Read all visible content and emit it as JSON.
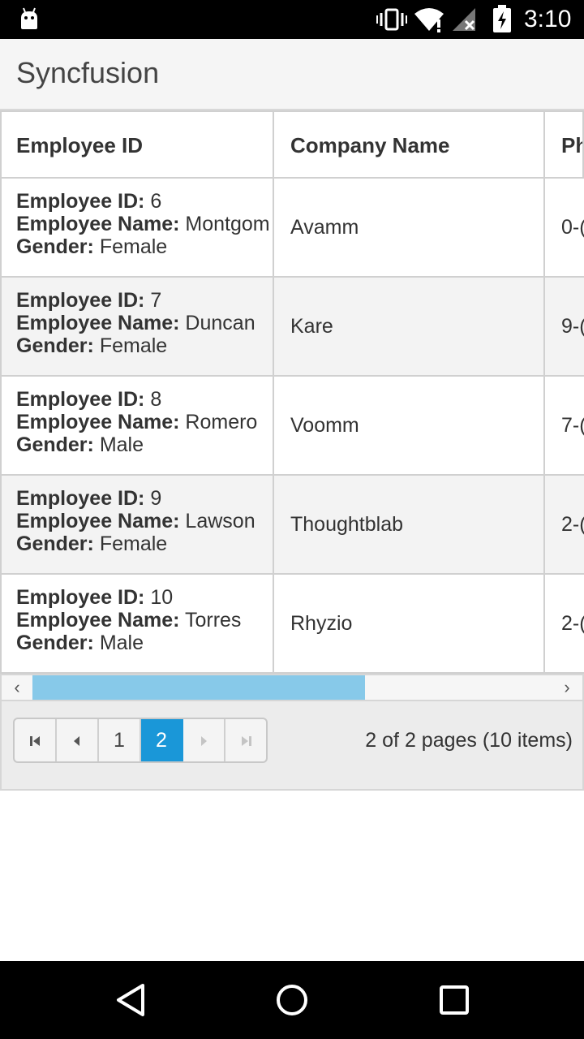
{
  "status_bar": {
    "time": "3:10",
    "icons": [
      "android-icon",
      "vibrate-icon",
      "wifi-icon",
      "signal-icon",
      "battery-icon"
    ]
  },
  "app_bar": {
    "title": "Syncfusion"
  },
  "grid": {
    "columns": [
      "Employee ID",
      "Company Name",
      "Phone"
    ],
    "column_visible_text": [
      "Employee ID",
      "Company Name",
      "Ph"
    ],
    "field_labels": {
      "id": "Employee ID:",
      "name": "Employee Name:",
      "gender": "Gender:"
    },
    "rows": [
      {
        "id": "6",
        "name": "Montgom",
        "gender": "Female",
        "company": "Avamm",
        "phone": "0-("
      },
      {
        "id": "7",
        "name": "Duncan",
        "gender": "Female",
        "company": "Kare",
        "phone": "9-("
      },
      {
        "id": "8",
        "name": "Romero",
        "gender": "Male",
        "company": "Voomm",
        "phone": "7-("
      },
      {
        "id": "9",
        "name": "Lawson",
        "gender": "Female",
        "company": "Thoughtblab",
        "phone": "2-("
      },
      {
        "id": "10",
        "name": "Torres",
        "gender": "Male",
        "company": "Rhyzio",
        "phone": "2-("
      }
    ]
  },
  "scrollbar": {
    "left_arrow": "‹",
    "right_arrow": "›",
    "thumb_fraction": 0.64
  },
  "pager": {
    "pages": [
      "1",
      "2"
    ],
    "current_page": "2",
    "info": "2 of 2 pages (10 items)"
  },
  "colors": {
    "accent": "#1a97d8",
    "scroll_thumb": "#87c9e9",
    "alt_row": "#f3f3f3"
  }
}
